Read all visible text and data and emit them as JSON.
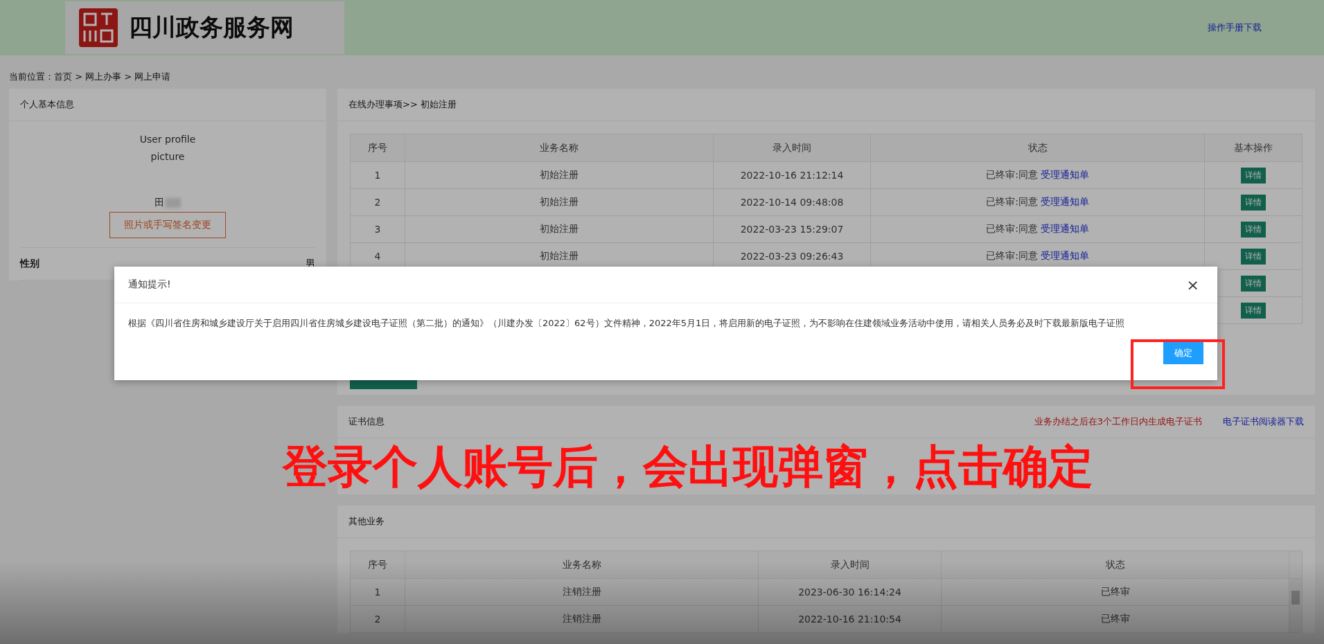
{
  "header": {
    "site_title": "四川政务服务网",
    "manual_link": "操作手册下载"
  },
  "breadcrumb": "当前位置：首页 > 网上办事 > 网上申请",
  "profile": {
    "title": "个人基本信息",
    "photo_alt": [
      "User profile",
      "picture"
    ],
    "name": "田",
    "change_button": "照片或手写签名变更",
    "fields": [
      {
        "label": "性别",
        "value": "男"
      }
    ]
  },
  "online": {
    "title": "在线办理事项>> 初始注册",
    "columns": [
      "序号",
      "业务名称",
      "录入时间",
      "状态",
      "基本操作"
    ],
    "rows": [
      {
        "no": "1",
        "name": "初始注册",
        "time": "2022-10-16 21:12:14",
        "status": "已终审:同意",
        "link": "受理通知单",
        "action": "详情"
      },
      {
        "no": "2",
        "name": "初始注册",
        "time": "2022-10-14 09:48:08",
        "status": "已终审:同意",
        "link": "受理通知单",
        "action": "详情"
      },
      {
        "no": "3",
        "name": "初始注册",
        "time": "2022-03-23 15:29:07",
        "status": "已终审:同意",
        "link": "受理通知单",
        "action": "详情"
      },
      {
        "no": "4",
        "name": "初始注册",
        "time": "2022-03-23 09:26:43",
        "status": "已终审:同意",
        "link": "受理通知单",
        "action": "详情"
      },
      {
        "action": "详情"
      },
      {
        "action": "详情"
      }
    ]
  },
  "certificate": {
    "title": "证书信息",
    "notice": "业务办结之后在3个工作日内生成电子证书",
    "reader_link": "电子证书阅读器下载"
  },
  "other": {
    "title": "其他业务",
    "columns": [
      "序号",
      "业务名称",
      "录入时间",
      "状态"
    ],
    "rows": [
      {
        "no": "1",
        "name": "注销注册",
        "time": "2023-06-30 16:14:24",
        "status": "已终审"
      },
      {
        "no": "2",
        "name": "注销注册",
        "time": "2022-10-16 21:10:54",
        "status": "已终审"
      }
    ]
  },
  "modal": {
    "title": "通知提示!",
    "close": "×",
    "message": "根据《四川省住房和城乡建设厅关于启用四川省住房城乡建设电子证照（第二批）的通知》（川建办发〔2022〕62号）文件精神，2022年5月1日，将启用新的电子证照，为不影响在住建领域业务活动中使用，请相关人员务必及时下载最新版电子证照",
    "confirm": "确定"
  },
  "caption": "登录个人账号后，会出现弹窗，点击确定"
}
